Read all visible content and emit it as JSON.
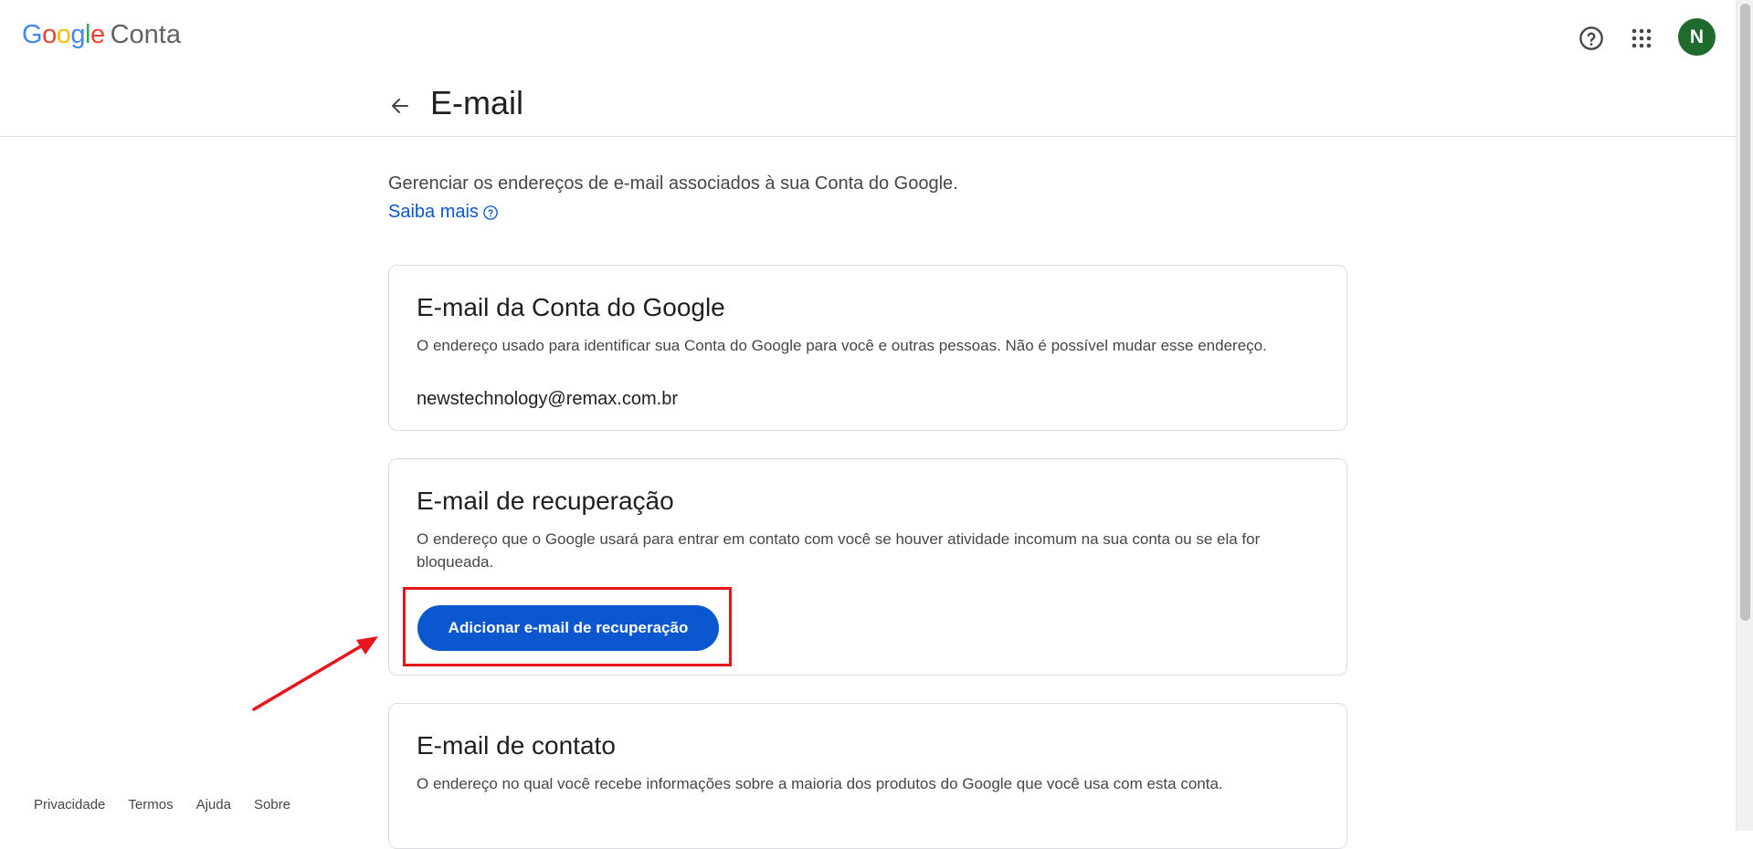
{
  "header": {
    "logo_google": "Google",
    "logo_product": "Conta",
    "avatar_initial": "N"
  },
  "page": {
    "title": "E-mail",
    "intro": "Gerenciar os endereços de e-mail associados à sua Conta do Google.",
    "learn_more": "Saiba mais"
  },
  "cards": {
    "account_email": {
      "title": "E-mail da Conta do Google",
      "description": "O endereço usado para identificar sua Conta do Google para você e outras pessoas. Não é possível mudar esse endereço.",
      "value": "newstechnology@remax.com.br"
    },
    "recovery_email": {
      "title": "E-mail de recuperação",
      "description": "O endereço que o Google usará para entrar em contato com você se houver atividade incomum na sua conta ou se ela for bloqueada.",
      "button_label": "Adicionar e-mail de recuperação"
    },
    "contact_email": {
      "title": "E-mail de contato",
      "description": "O endereço no qual você recebe informações sobre a maioria dos produtos do Google que você usa com esta conta."
    }
  },
  "footer": {
    "privacy": "Privacidade",
    "terms": "Termos",
    "help": "Ajuda",
    "about": "Sobre"
  },
  "colors": {
    "accent": "#0b57d0",
    "avatar_bg": "#1e6b2d",
    "annotation_red": "#e8141c"
  },
  "icons": {
    "help": "help-circle-icon",
    "apps": "apps-grid-icon",
    "back": "arrow-back-icon",
    "learn_more": "help-outline-icon"
  }
}
